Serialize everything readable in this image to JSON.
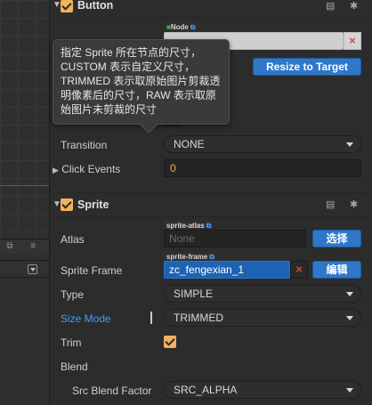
{
  "button_section": {
    "title": "Button",
    "node_tag": "Node",
    "resize_button": "Resize to Target",
    "transition_label": "Transition",
    "transition_value": "NONE",
    "click_events_label": "Click Events",
    "click_events_value": "0"
  },
  "tooltip": {
    "lines": [
      "指定 Sprite 所在节点的尺寸，",
      "CUSTOM 表示自定义尺寸，",
      "TRIMMED 表示取原始图片剪裁透",
      "明像素后的尺寸，RAW 表示取原",
      "始图片未剪裁的尺寸"
    ]
  },
  "sprite_section": {
    "title": "Sprite",
    "atlas_label": "Atlas",
    "atlas_tag": "sprite-atlas",
    "atlas_placeholder": "None",
    "atlas_button": "选择",
    "frame_label": "Sprite Frame",
    "frame_tag": "sprite-frame",
    "frame_value": "zc_fengexian_1",
    "frame_button": "编辑",
    "type_label": "Type",
    "type_value": "SIMPLE",
    "size_mode_label": "Size Mode",
    "size_mode_value": "TRIMMED",
    "trim_label": "Trim",
    "blend_label": "Blend",
    "src_blend_label": "Src Blend Factor",
    "src_blend_value": "SRC_ALPHA"
  },
  "icons": {
    "book": "book-icon",
    "gear": "gear-icon",
    "link": "link-icon",
    "clear": "clear-icon"
  },
  "colors": {
    "accent_orange": "#f2b25c",
    "link_blue": "#3aa0ff",
    "button_blue": "#2f77c8",
    "clear_red": "#d64545"
  }
}
